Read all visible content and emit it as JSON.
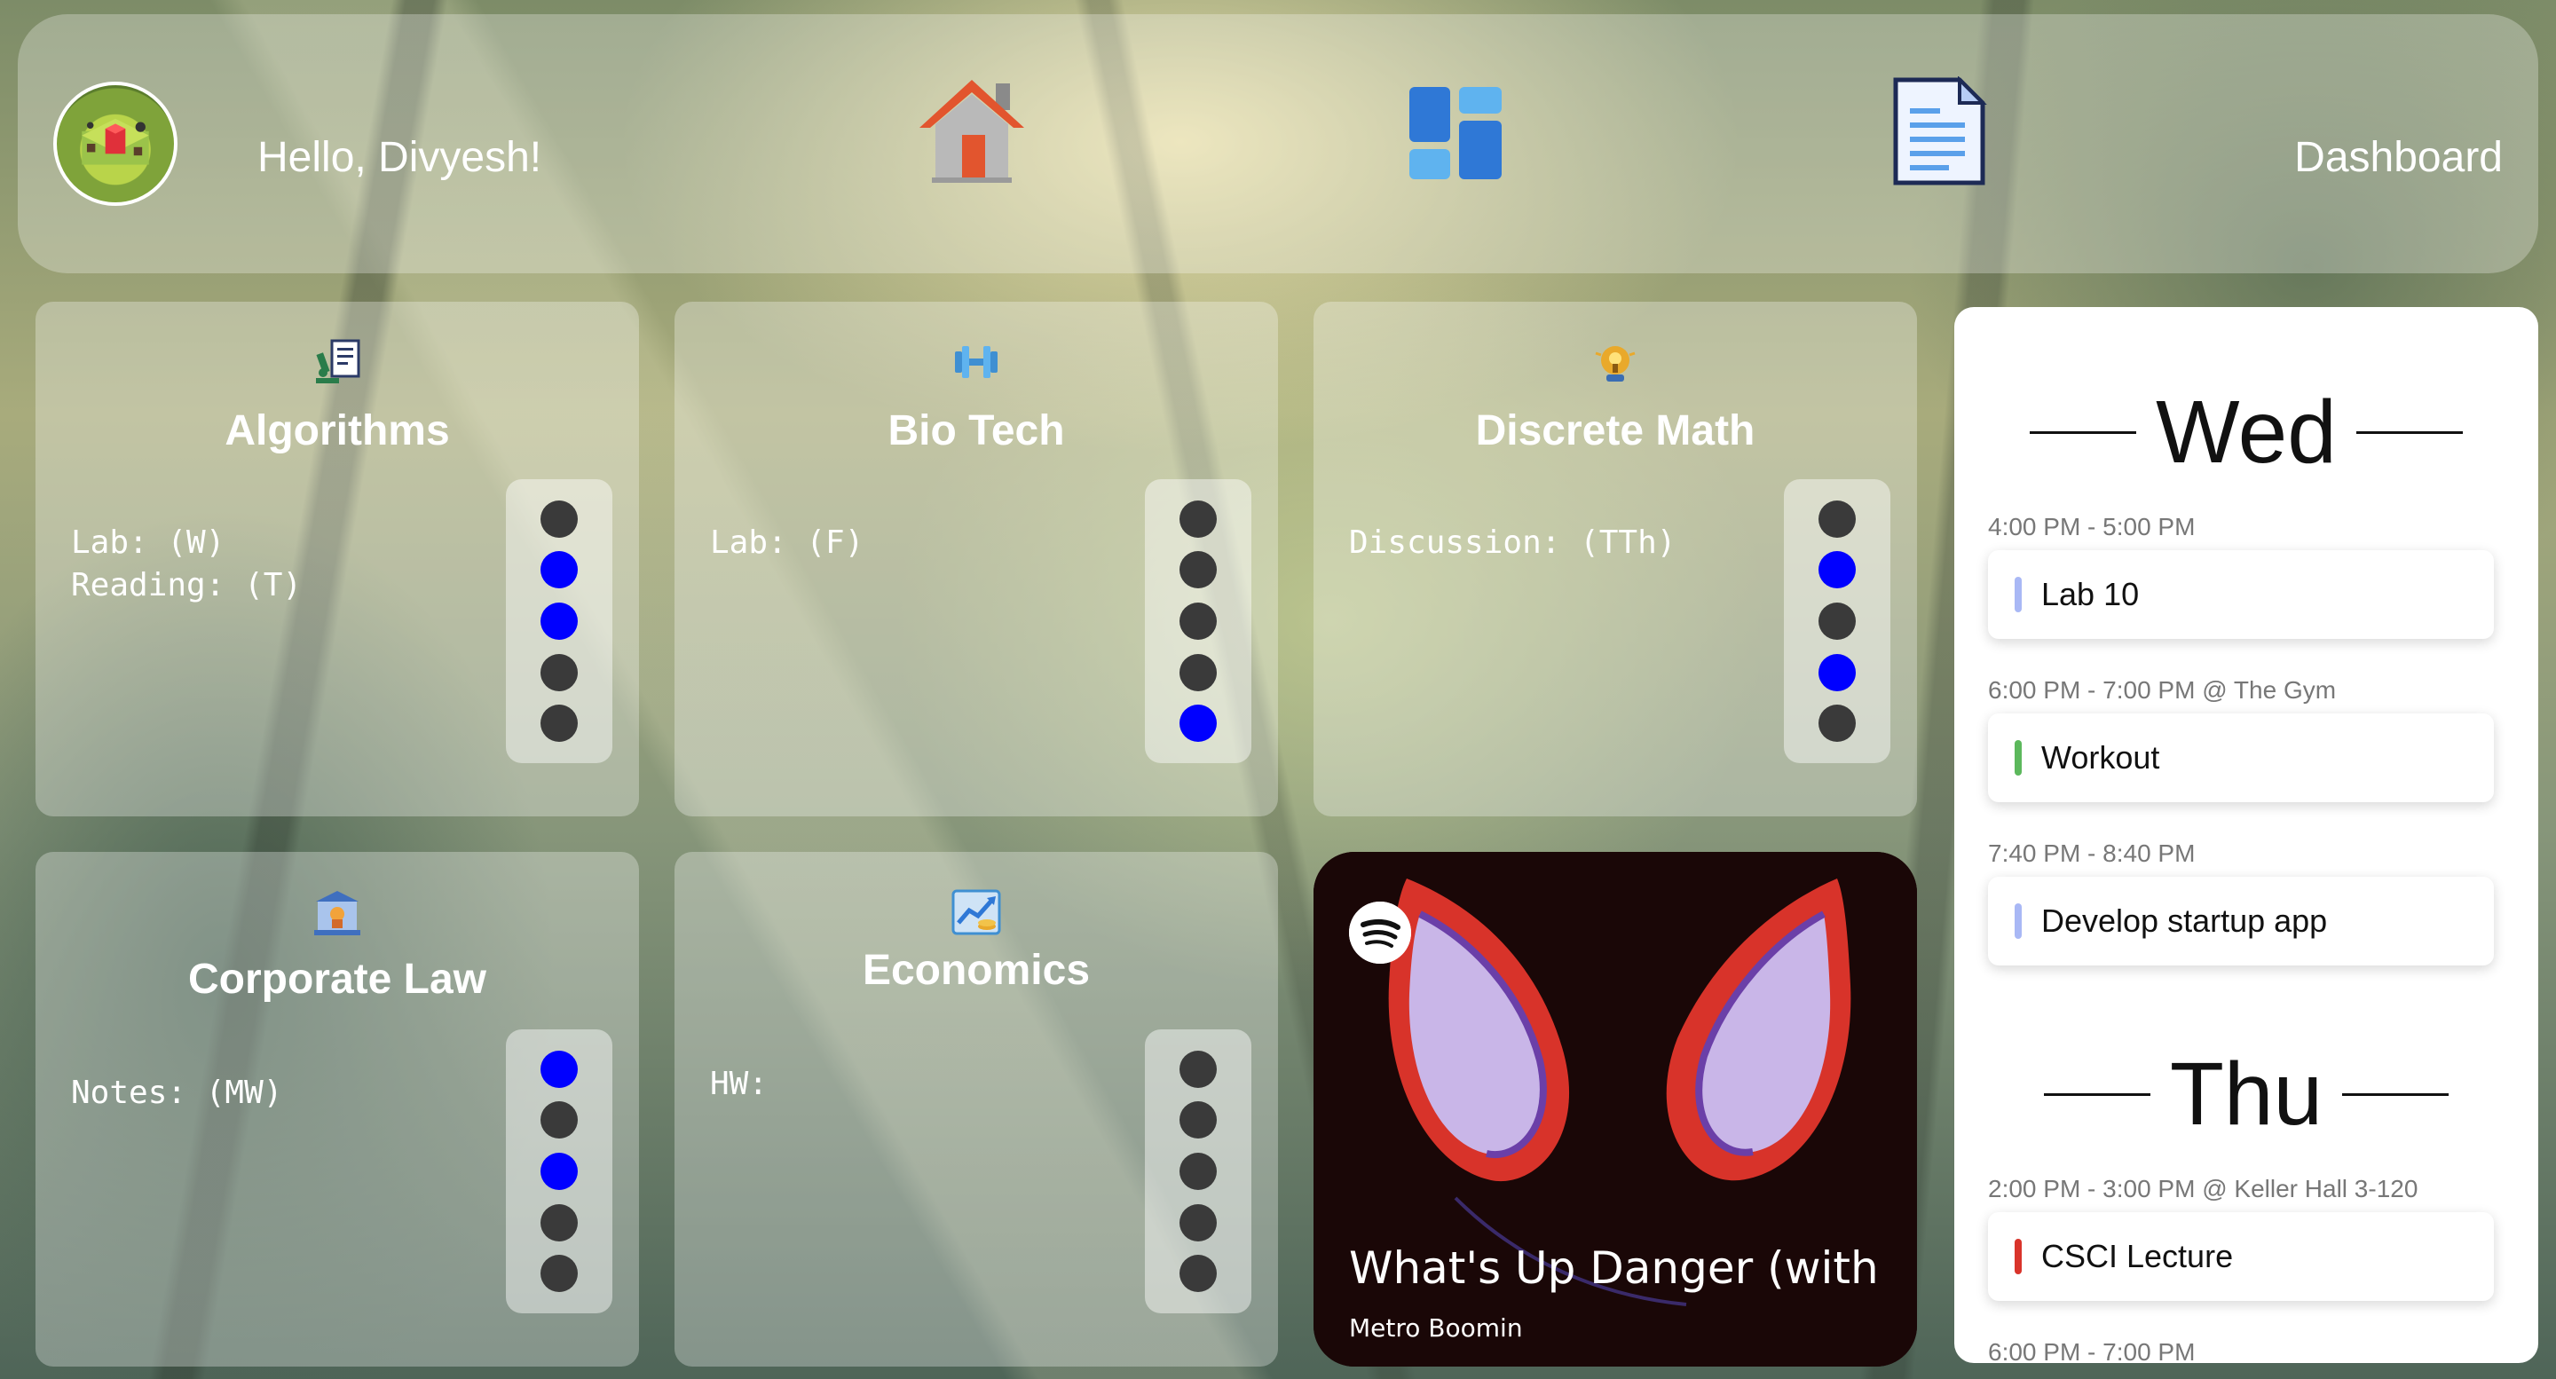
{
  "header": {
    "greeting": "Hello, Divyesh!",
    "nav": [
      {
        "name": "home",
        "icon": "house-icon"
      },
      {
        "name": "widgets",
        "icon": "layout-grid-icon"
      },
      {
        "name": "documents",
        "icon": "document-icon"
      }
    ],
    "dashboard_label": "Dashboard"
  },
  "courses": [
    {
      "title": "Algorithms",
      "icon": "microscope-document-icon",
      "notes": "Lab: (W)\nReading: (T)",
      "dots": [
        false,
        true,
        true,
        false,
        false
      ]
    },
    {
      "title": "Bio Tech",
      "icon": "dumbbell-icon",
      "notes": "Lab: (F)",
      "dots": [
        false,
        false,
        false,
        false,
        true
      ]
    },
    {
      "title": "Discrete Math",
      "icon": "lightbulb-head-icon",
      "notes": "Discussion: (TTh)",
      "dots": [
        false,
        true,
        false,
        true,
        false
      ]
    },
    {
      "title": "Corporate Law",
      "icon": "courthouse-icon",
      "notes": "Notes: (MW)",
      "dots": [
        true,
        false,
        true,
        false,
        false
      ]
    },
    {
      "title": "Economics",
      "icon": "chart-increasing-icon",
      "notes": "HW:",
      "dots": [
        false,
        false,
        false,
        false,
        false
      ]
    }
  ],
  "music": {
    "song": "What's Up Danger (with Blackway & Black Caviar)",
    "artist": "Metro Boomin",
    "service_icon": "spotify-icon"
  },
  "calendar": {
    "days": [
      {
        "label": "Wed",
        "events": [
          {
            "time": "4:00 PM - 5:00 PM",
            "title": "Lab 10",
            "color": "#a9b8f5"
          },
          {
            "time": "6:00 PM - 7:00 PM @ The Gym",
            "title": "Workout",
            "color": "#5cb85c"
          },
          {
            "time": "7:40 PM - 8:40 PM",
            "title": "Develop startup app",
            "color": "#a9b8f5"
          }
        ]
      },
      {
        "label": "Thu",
        "events": [
          {
            "time": "2:00 PM - 3:00 PM @ Keller Hall 3-120",
            "title": "CSCI Lecture",
            "color": "#d9342b"
          },
          {
            "time": "6:00 PM - 7:00 PM",
            "title": ""
          }
        ]
      }
    ]
  }
}
